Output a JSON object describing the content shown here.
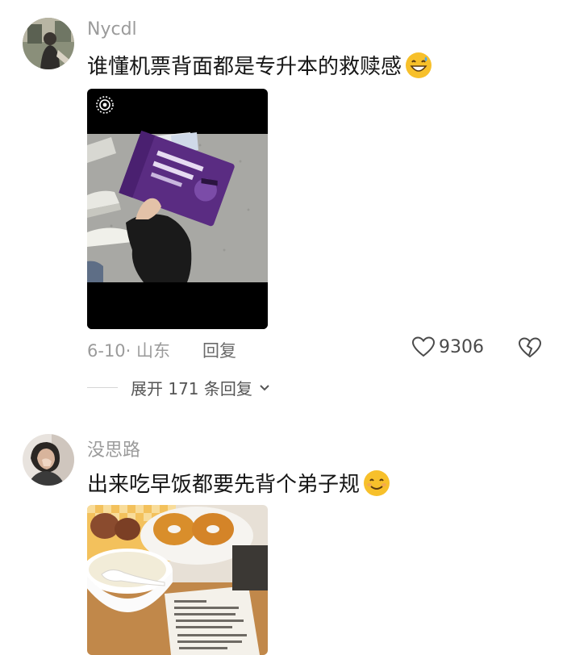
{
  "comments": [
    {
      "username": "Nycdl",
      "text": "谁懂机票背面都是专升本的救赎感",
      "emoji": "grinning-sweat-emoji",
      "media": "video-thumbnail",
      "date_location": "6-10· 山东",
      "reply_label": "回复",
      "like_count": "9306",
      "expand_label": "展开 171 条回复"
    },
    {
      "username": "没思路",
      "text": "出来吃早饭都要先背个弟子规",
      "emoji": "smiling-emoji",
      "media": "breakfast-photo"
    }
  ],
  "icons": {
    "like": "heart-outline-icon",
    "dislike": "broken-heart-icon",
    "expand": "chevron-down-icon",
    "live": "live-photo-icon"
  },
  "colors": {
    "text_primary": "#161616",
    "text_secondary": "#9b9b9b",
    "purple_ticket": "#5a2c82",
    "emoji_yellow": "#f7c02b"
  }
}
